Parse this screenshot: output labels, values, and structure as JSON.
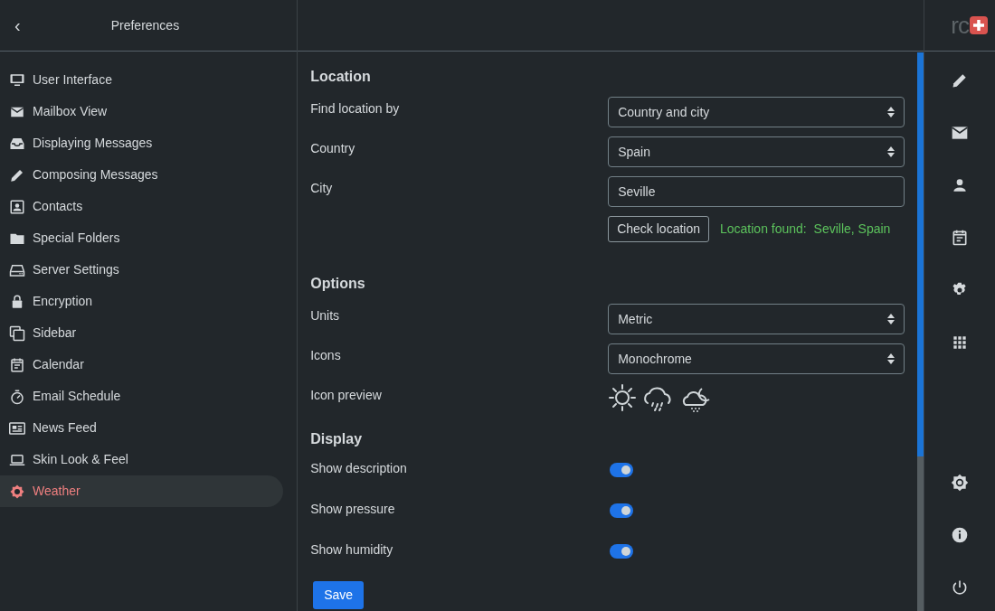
{
  "header": {
    "back": "‹",
    "title": "Preferences",
    "logo": "rc"
  },
  "sidebar": {
    "items": [
      {
        "label": "User Interface",
        "selected": false
      },
      {
        "label": "Mailbox View",
        "selected": false
      },
      {
        "label": "Displaying Messages",
        "selected": false
      },
      {
        "label": "Composing Messages",
        "selected": false
      },
      {
        "label": "Contacts",
        "selected": false
      },
      {
        "label": "Special Folders",
        "selected": false
      },
      {
        "label": "Server Settings",
        "selected": false
      },
      {
        "label": "Encryption",
        "selected": false
      },
      {
        "label": "Sidebar",
        "selected": false
      },
      {
        "label": "Calendar",
        "selected": false
      },
      {
        "label": "Email Schedule",
        "selected": false
      },
      {
        "label": "News Feed",
        "selected": false
      },
      {
        "label": "Skin Look & Feel",
        "selected": false
      },
      {
        "label": "Weather",
        "selected": true
      }
    ]
  },
  "sections": [
    {
      "title": "Location",
      "rows": [
        {
          "kind": "select",
          "label": "Find location by",
          "value": "Country and city"
        },
        {
          "kind": "select",
          "label": "Country",
          "value": "Spain"
        },
        {
          "kind": "text",
          "label": "City",
          "value": "Seville"
        },
        {
          "kind": "check",
          "button": "Check location",
          "status_label": "Location found:",
          "status_value": "Seville, Spain"
        }
      ]
    },
    {
      "title": "Options",
      "rows": [
        {
          "kind": "select",
          "label": "Units",
          "value": "Metric"
        },
        {
          "kind": "select",
          "label": "Icons",
          "value": "Monochrome"
        },
        {
          "kind": "preview",
          "label": "Icon preview"
        }
      ]
    },
    {
      "title": "Display",
      "rows": [
        {
          "kind": "toggle",
          "label": "Show description",
          "on": true
        },
        {
          "kind": "toggle",
          "label": "Show pressure",
          "on": true
        },
        {
          "kind": "toggle",
          "label": "Show humidity",
          "on": true
        }
      ]
    }
  ],
  "save_button": "Save"
}
